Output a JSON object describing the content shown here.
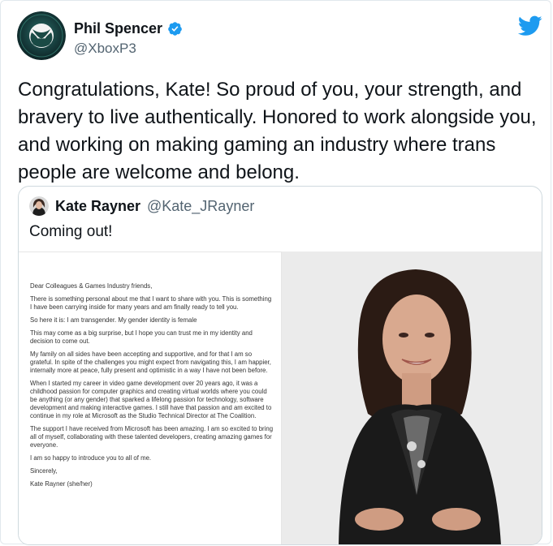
{
  "tweet": {
    "author": {
      "name": "Phil Spencer",
      "handle": "@XboxP3",
      "avatar_icon": "xbox-logo-icon",
      "verified_icon": "verified-badge-icon"
    },
    "platform_icon": "twitter-bird-icon",
    "text": "Congratulations, Kate! So proud of you, your strength, and bravery to live authentically. Honored to work alongside you, and working on making gaming an industry where trans people are welcome and belong.",
    "quoted": {
      "author_name": "Kate Rayner",
      "author_handle": "@Kate_JRayner",
      "text": "Coming out!",
      "letter": {
        "greeting": "Dear Colleagues & Games Industry friends,",
        "paragraphs": [
          "There is something personal about me that I want to share with you. This is something I have been carrying inside for many years and am finally ready to tell you.",
          "So here it is: I am transgender. My gender identity is female",
          "This may come as a big surprise, but I hope you can trust me in my identity and decision to come out.",
          "My family on all sides have been accepting and supportive, and for that I am so grateful. In spite of the challenges you might expect from navigating this, I am happier, internally more at peace, fully present and optimistic in a way I have not been before.",
          "When I started my career in video game development over 20 years ago, it was a childhood passion for computer graphics and creating virtual worlds where you could be anything (or any gender) that sparked a lifelong passion for technology, software development and making interactive games. I still have that passion and am excited to continue in my role at Microsoft as the Studio Technical Director at The Coalition.",
          "The support I have received from Microsoft has been amazing. I am so excited to bring all of myself, collaborating with these talented developers, creating amazing games for everyone.",
          "I am so happy to introduce you to all of me.",
          "Sincerely,",
          "Kate Rayner (she/her)"
        ]
      }
    }
  },
  "colors": {
    "twitter_blue": "#1d9bf0",
    "text_primary": "#0f1419",
    "text_secondary": "#536471",
    "border": "#cfd9de"
  }
}
